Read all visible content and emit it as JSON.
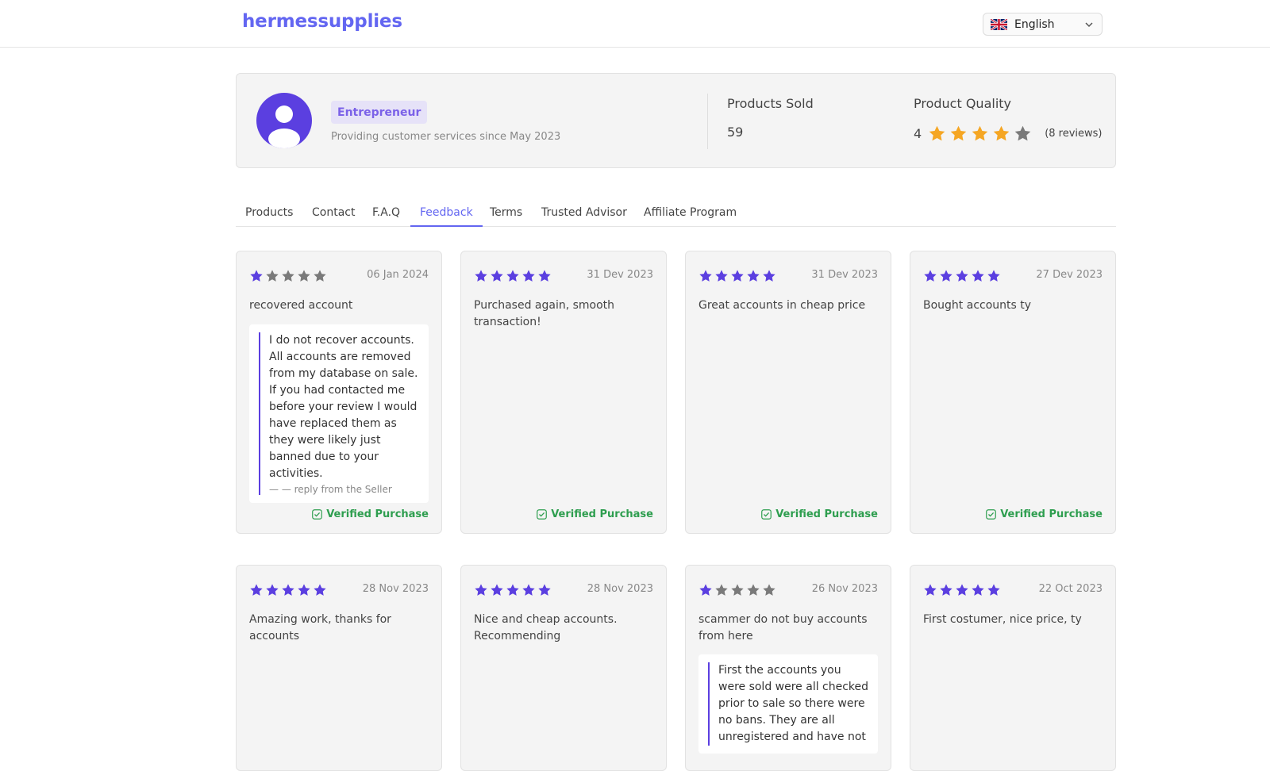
{
  "header": {
    "brand": "hermessupplies",
    "language": "English"
  },
  "profile": {
    "role": "Entrepreneur",
    "since": "Providing customer services since May 2023",
    "products_sold_label": "Products Sold",
    "products_sold_value": "59",
    "quality_label": "Product Quality",
    "quality_value": "4",
    "quality_rating": 4,
    "reviews": "(8 reviews)"
  },
  "tabs": [
    {
      "label": "Products"
    },
    {
      "label": "Contact"
    },
    {
      "label": "F.A.Q"
    },
    {
      "label": "Feedback",
      "active": true
    },
    {
      "label": "Terms"
    },
    {
      "label": "Trusted Advisor"
    },
    {
      "label": "Affiliate Program"
    }
  ],
  "verified_label": "Verified Purchase",
  "reviews": [
    {
      "rating": 1,
      "date": "06 Jan 2024",
      "text": "recovered account",
      "reply": "I do not recover accounts. All accounts are removed from my database on sale. If you had contacted me before your review I would have replaced them as they were likely just banned due to your activities.",
      "reply_by": "— — reply from the Seller"
    },
    {
      "rating": 5,
      "date": "31 Dev 2023",
      "text": "Purchased again, smooth transaction!"
    },
    {
      "rating": 5,
      "date": "31 Dev 2023",
      "text": "Great accounts in cheap price"
    },
    {
      "rating": 5,
      "date": "27 Dev 2023",
      "text": "Bought accounts ty"
    },
    {
      "rating": 5,
      "date": "28 Nov 2023",
      "text": "Amazing work, thanks for accounts"
    },
    {
      "rating": 5,
      "date": "28 Nov 2023",
      "text": "Nice and cheap accounts. Recommending"
    },
    {
      "rating": 1,
      "date": "26 Nov 2023",
      "text": "scammer do not buy accounts from here",
      "reply": "First the accounts you were sold were all checked prior to sale so there were no bans. They are all unregistered and have not"
    },
    {
      "rating": 5,
      "date": "22 Oct 2023",
      "text": "First costumer, nice price, ty"
    }
  ],
  "colors": {
    "accent": "#6366f1",
    "star_purple": "#5b3fe0",
    "star_gold": "#f5a623",
    "star_grey": "#7a7a7a",
    "verified_green": "#2e9e4f"
  }
}
